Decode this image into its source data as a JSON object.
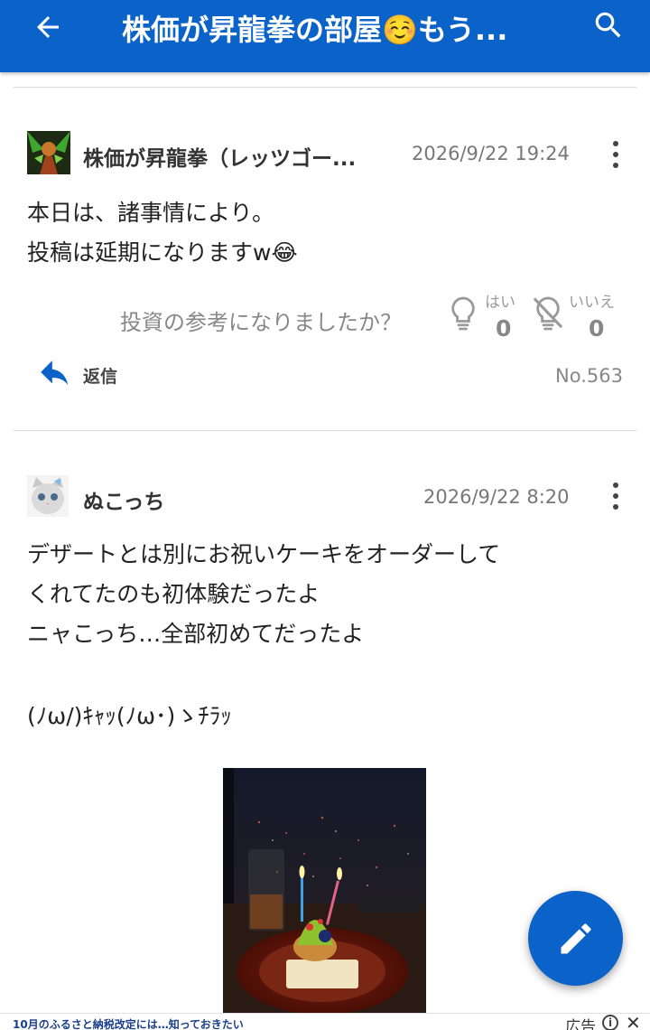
{
  "appbar": {
    "title": "株価が昇龍拳の部屋☺️もう...",
    "back_icon": "arrow-left-icon",
    "search_icon": "search-icon",
    "color": "#0b63c9"
  },
  "posts": [
    {
      "author": "株価が昇龍拳（レッツゴー...",
      "date": "2026/9/22 19:24",
      "lines": [
        "本日は、諸事情により。",
        "投稿は延期になりますw😂"
      ],
      "vote": {
        "question": "投資の参考になりましたか？",
        "yes_label": "はい",
        "yes_count": "0",
        "no_label": "いいえ",
        "no_count": "0"
      },
      "reply_label": "返信",
      "number": "No.563"
    },
    {
      "author": "ぬこっち",
      "date": "2026/9/22 8:20",
      "lines": [
        "デザートとは別にお祝いケーキをオーダーして",
        "くれてたのも初体験だったよ",
        "ニャこっち…全部初めてだったよ",
        "",
        "(ﾉω/)ｷｬｯ(ﾉω･)ゝﾁﾗｯ"
      ]
    }
  ],
  "fab": {
    "icon": "pencil-icon"
  },
  "ad": {
    "text": "10月のふるさと納税改定には…知っておきたい",
    "label": "広告",
    "info_icon": "info-icon",
    "close_icon": "close-icon"
  }
}
